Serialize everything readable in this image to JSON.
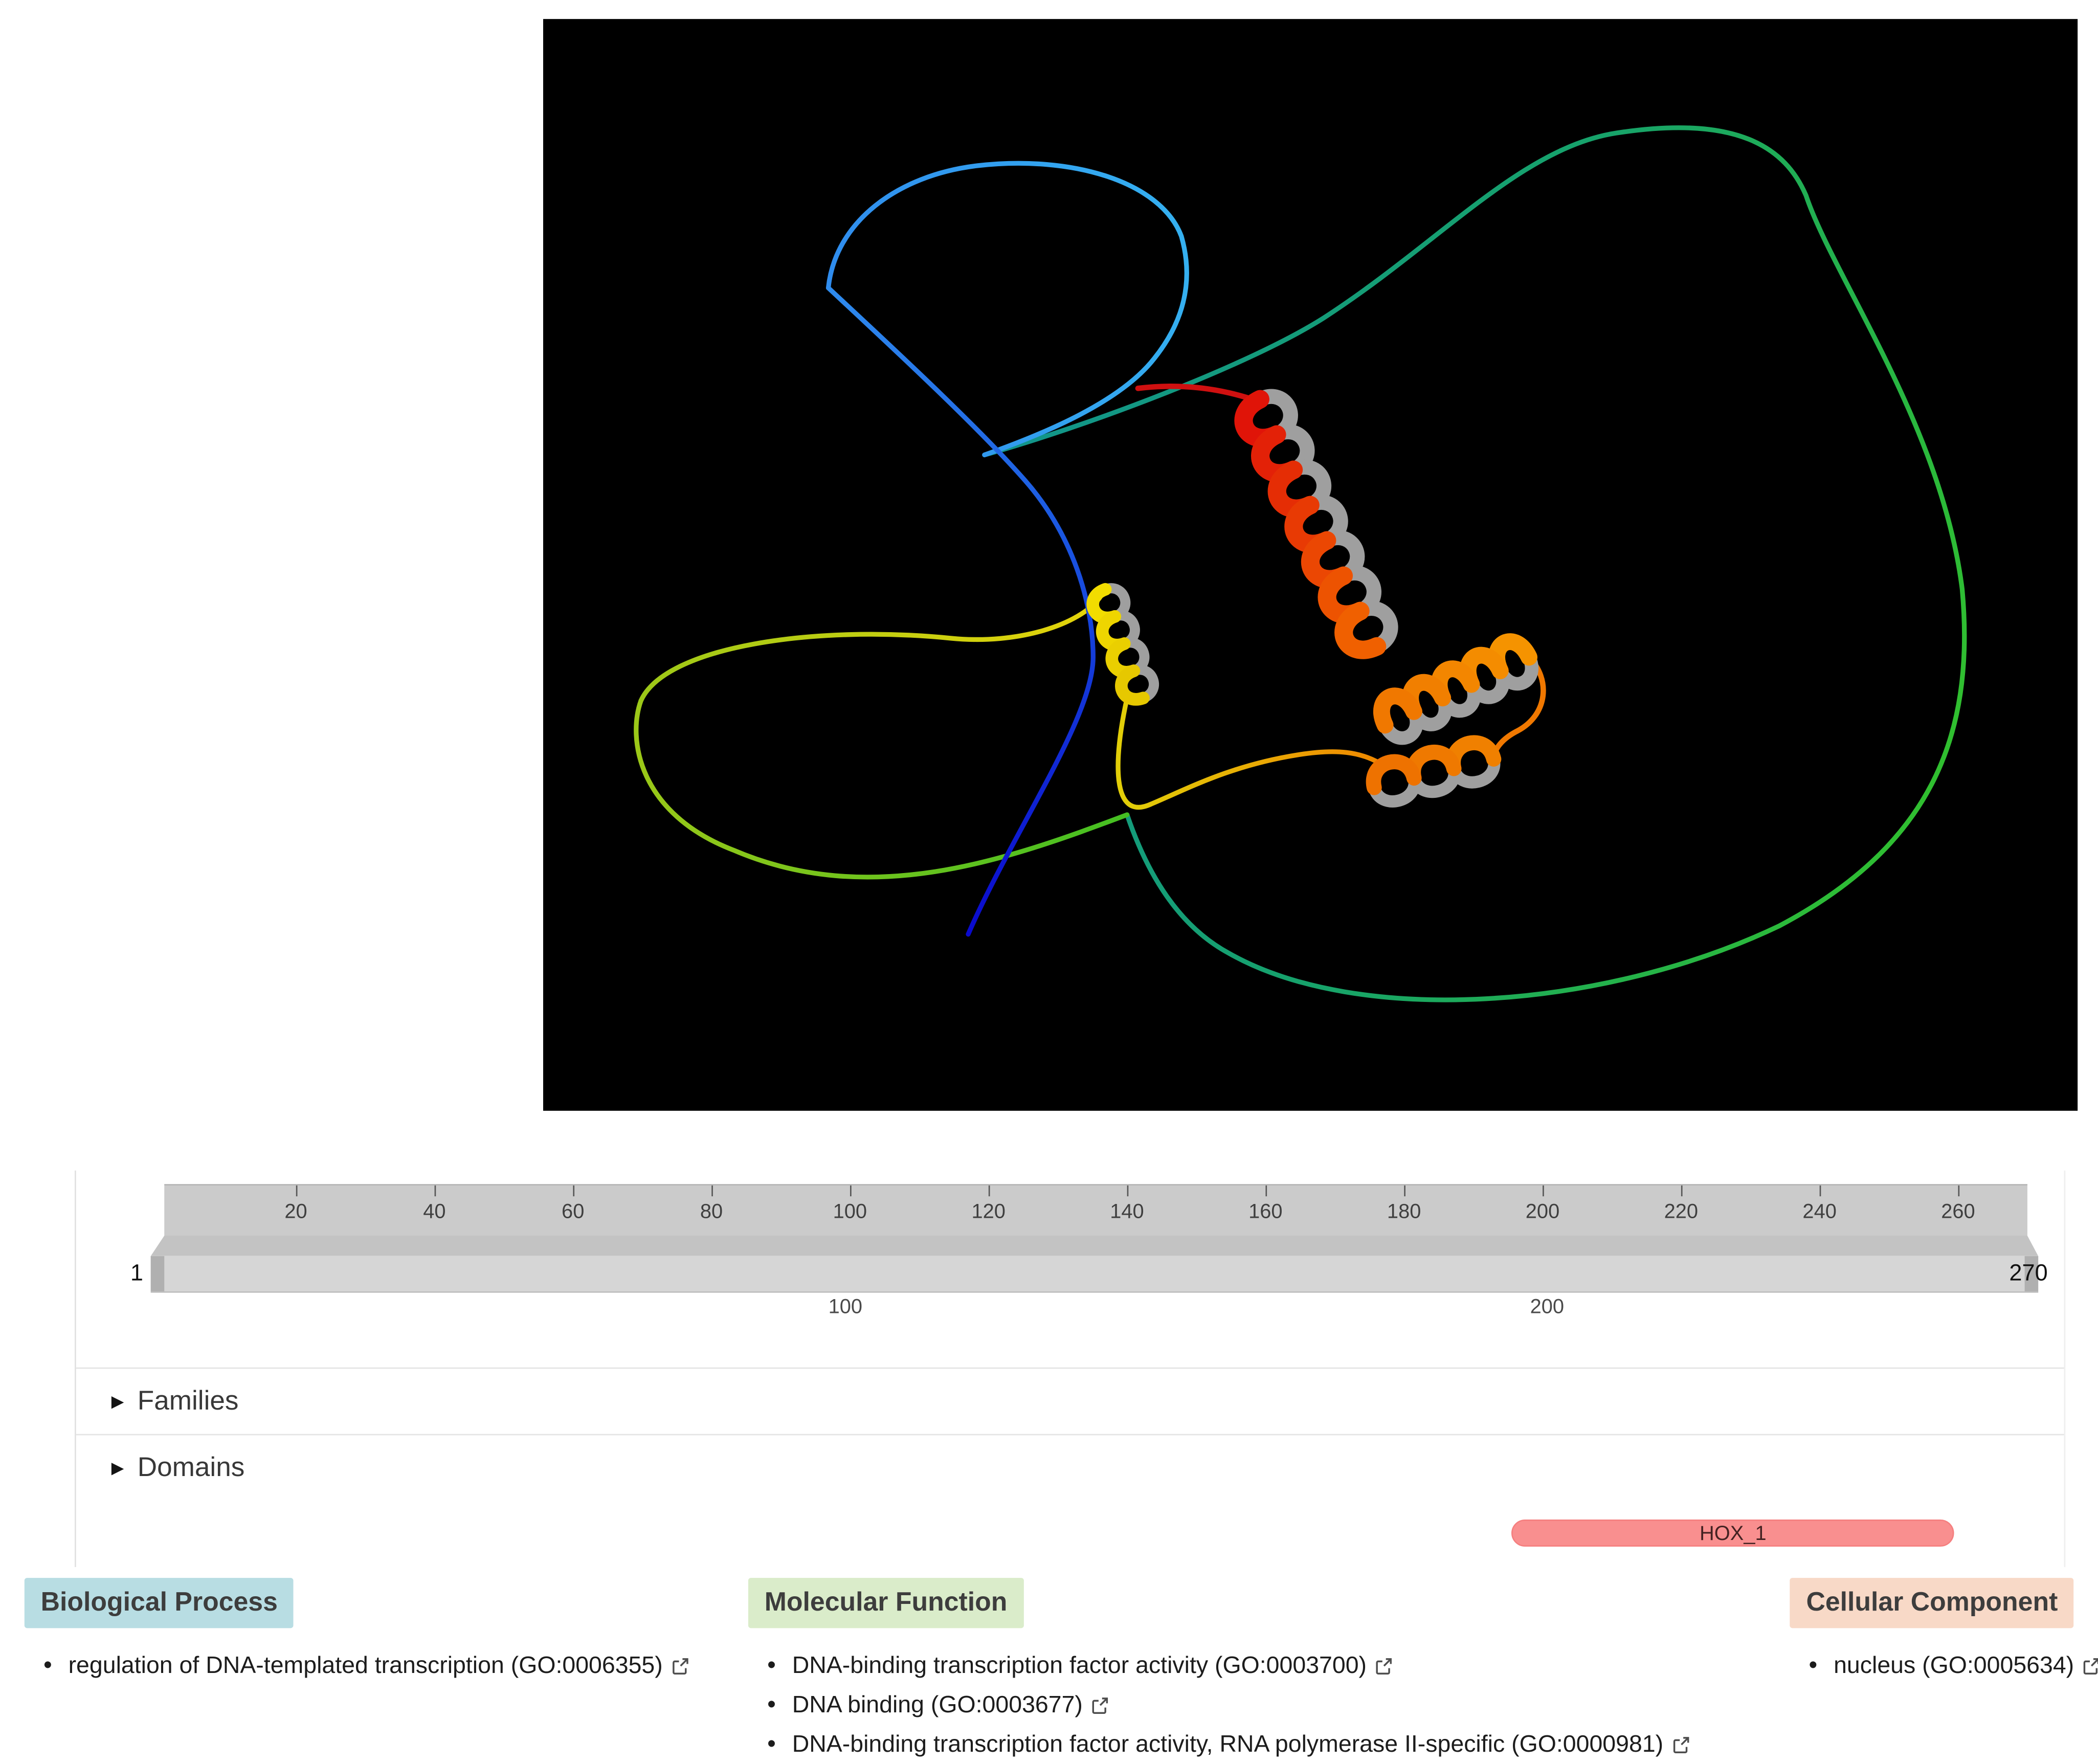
{
  "viewer": {
    "background": "#000000"
  },
  "sequence": {
    "start": 1,
    "end": 270,
    "start_label": "1",
    "end_label": "270",
    "ruler_ticks": [
      20,
      40,
      60,
      80,
      100,
      120,
      140,
      160,
      180,
      200,
      220,
      240,
      260
    ],
    "axis_labels": [
      100,
      200
    ]
  },
  "tracks": {
    "families": {
      "label": "Families"
    },
    "domains": {
      "label": "Domains",
      "items": [
        {
          "name": "HOX_1",
          "start": 195,
          "end": 258,
          "color": "#f98f8f"
        }
      ]
    }
  },
  "go_annotations": [
    {
      "title": "Biological Process",
      "color": "#b8dde3",
      "items": [
        "regulation of DNA-templated transcription (GO:0006355)"
      ]
    },
    {
      "title": "Molecular Function",
      "color": "#daecca",
      "items": [
        "DNA-binding transcription factor activity (GO:0003700)",
        "DNA binding (GO:0003677)",
        "DNA-binding transcription factor activity, RNA polymerase II-specific (GO:0000981)"
      ]
    },
    {
      "title": "Cellular Component",
      "color": "#f8d9c7",
      "items": [
        "nucleus (GO:0005634)"
      ]
    }
  ]
}
